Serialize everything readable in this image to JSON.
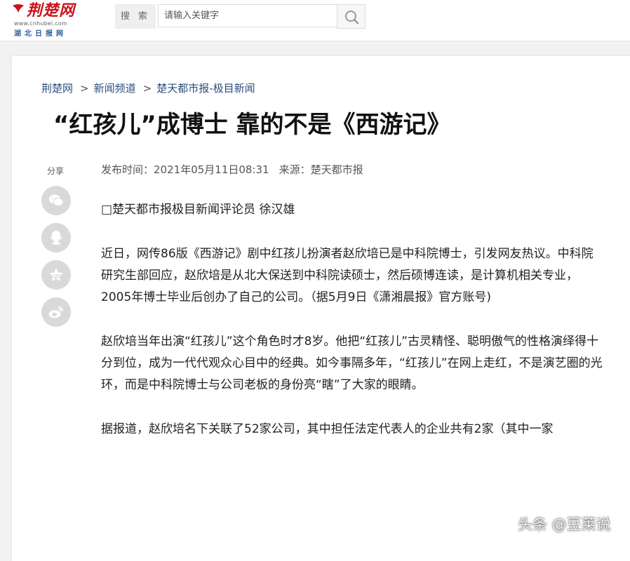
{
  "header": {
    "logo_title": "荆楚网",
    "logo_url": "www.cnhubei.com",
    "logo_sub": "湖北日报网",
    "search_label": "搜 索",
    "search_placeholder": "请输入关键字"
  },
  "breadcrumb": [
    "荆楚网",
    "新闻频道",
    "楚天都市报-极目新闻"
  ],
  "breadcrumb_separator": ">",
  "article": {
    "title": "“红孩儿”成博士 靠的不是《西游记》",
    "meta": {
      "publish_label": "发布时间：",
      "publish_time": "2021年05月11日08:31",
      "source_label": "来源：",
      "source": "楚天都市报"
    },
    "paragraphs": [
      "□楚天都市报极目新闻评论员 徐汉雄",
      "近日，网传86版《西游记》剧中红孩儿扮演者赵欣培已是中科院博士，引发网友热议。中科院研究生部回应，赵欣培是从北大保送到中科院读硕士，然后硕博连读，是计算机相关专业，2005年博士毕业后创办了自己的公司。（据5月9日《潇湘晨报》官方账号)",
      "赵欣培当年出演“红孩儿”这个角色时才8岁。他把“红孩儿”古灵精怪、聪明傲气的性格演绎得十分到位，成为一代代观众心目中的经典。如今事隔多年，“红孩儿”在网上走红，不是演艺圈的光环，而是中科院博士与公司老板的身份亮“瞎”了大家的眼睛。",
      "据报道，赵欣培名下关联了52家公司，其中担任法定代表人的企业共有2家（其中一家"
    ]
  },
  "share": {
    "label": "分享",
    "icons": [
      "wechat-icon",
      "qq-icon",
      "qzone-icon",
      "weibo-icon"
    ]
  },
  "watermark": "头条 @豆莱说",
  "colors": {
    "brand_red": "#c8161d",
    "breadcrumb_link": "#2c4f7c",
    "share_icon_bg": "#d9d9d9"
  }
}
